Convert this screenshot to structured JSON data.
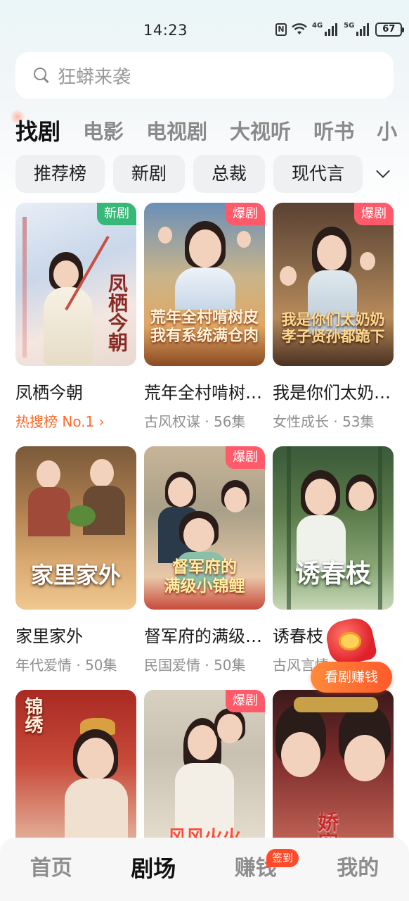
{
  "status_bar": {
    "time": "14:23",
    "network_4g": "4G",
    "network_5g": "5G",
    "battery": "67",
    "icons": [
      "nfc-icon",
      "wifi-icon",
      "signal-icon",
      "signal-icon",
      "battery-icon"
    ]
  },
  "search": {
    "placeholder": "狂蟒来袭"
  },
  "category_tabs": [
    {
      "label": "找剧",
      "active": true
    },
    {
      "label": "电影",
      "active": false
    },
    {
      "label": "电视剧",
      "active": false
    },
    {
      "label": "大视听",
      "active": false
    },
    {
      "label": "听书",
      "active": false
    },
    {
      "label": "小",
      "active": false
    }
  ],
  "filters": [
    {
      "label": "推荐榜"
    },
    {
      "label": "新剧"
    },
    {
      "label": "总裁"
    },
    {
      "label": "现代言"
    }
  ],
  "dramas": [
    {
      "title": "凤栖今朝",
      "subtitle": "热搜榜 No.1 ›",
      "badge": "新剧",
      "badge_type": "new",
      "poster_text": "凤栖今朝",
      "rank": true
    },
    {
      "title": "荒年全村啃树皮，我有系统满仓肉",
      "subtitle": "古风权谋 · 56集",
      "badge": "爆剧",
      "badge_type": "hot",
      "poster_text": "荒年全村啃树皮\n我有系统满仓肉",
      "rank": false
    },
    {
      "title": "我是你们太奶奶，孝子贤孙都跪下",
      "subtitle": "女性成长 · 53集",
      "badge": "爆剧",
      "badge_type": "hot",
      "poster_text": "我是你们太奶奶\n孝子贤孙都跪下",
      "rank": false
    },
    {
      "title": "家里家外",
      "subtitle": "年代爱情 · 50集",
      "badge": "",
      "badge_type": "",
      "poster_text": "家里家外",
      "rank": false
    },
    {
      "title": "督军府的满级小锦鲤",
      "subtitle": "民国爱情 · 50集",
      "badge": "爆剧",
      "badge_type": "hot",
      "poster_text": "督军府的\n满级小锦鲤",
      "rank": false
    },
    {
      "title": "诱春枝",
      "subtitle": "古风言情",
      "badge": "",
      "badge_type": "",
      "poster_text": "诱春枝",
      "rank": false
    },
    {
      "title": "",
      "subtitle": "",
      "badge": "",
      "badge_type": "",
      "poster_text": "锦绣",
      "rank": false
    },
    {
      "title": "",
      "subtitle": "",
      "badge": "爆剧",
      "badge_type": "hot",
      "poster_text": "风风火火",
      "rank": false
    },
    {
      "title": "",
      "subtitle": "",
      "badge": "",
      "badge_type": "",
      "poster_text": "娇宠",
      "rank": false
    }
  ],
  "reward": {
    "label": "看剧赚钱"
  },
  "bottom_nav": [
    {
      "label": "首页",
      "active": false,
      "badge": ""
    },
    {
      "label": "剧场",
      "active": true,
      "badge": ""
    },
    {
      "label": "赚钱",
      "active": false,
      "badge": "签到"
    },
    {
      "label": "我的",
      "active": false,
      "badge": ""
    }
  ],
  "colors": {
    "accent_orange": "#ff6a2a",
    "badge_new": "#38b878",
    "badge_hot": "#ff5a6a",
    "chip_bg": "#eef0f2"
  }
}
